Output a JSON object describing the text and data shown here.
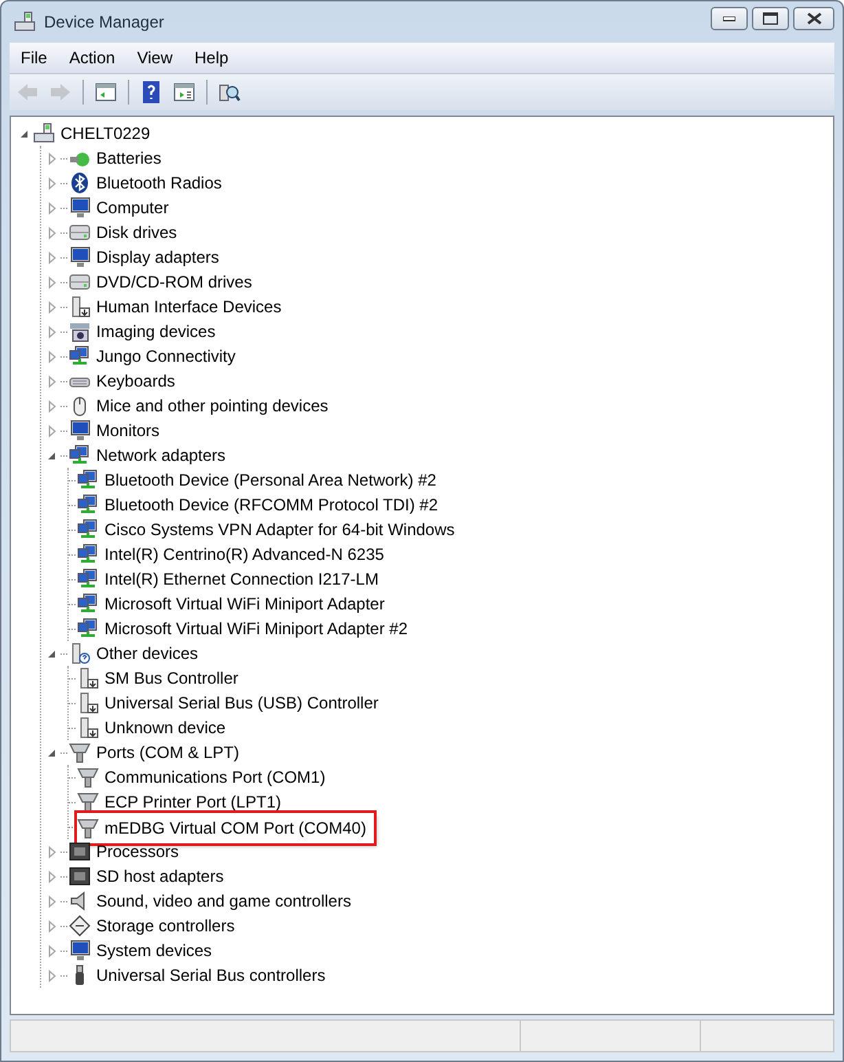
{
  "window": {
    "title": "Device Manager"
  },
  "menu": [
    "File",
    "Action",
    "View",
    "Help"
  ],
  "toolbar": [
    {
      "kind": "back",
      "disabled": true
    },
    {
      "kind": "forward",
      "disabled": true
    },
    {
      "kind": "tree",
      "disabled": false
    },
    {
      "kind": "help",
      "disabled": false
    },
    {
      "kind": "properties",
      "disabled": false
    },
    {
      "kind": "scan",
      "disabled": false
    }
  ],
  "tree": {
    "label": "CHELT0229",
    "kind": "computer",
    "expanded": true,
    "children": [
      {
        "label": "Batteries",
        "kind": "battery",
        "expanded": false
      },
      {
        "label": "Bluetooth Radios",
        "kind": "bluetooth",
        "expanded": false
      },
      {
        "label": "Computer",
        "kind": "monitor",
        "expanded": false
      },
      {
        "label": "Disk drives",
        "kind": "disk",
        "expanded": false
      },
      {
        "label": "Display adapters",
        "kind": "monitor",
        "expanded": false
      },
      {
        "label": "DVD/CD-ROM drives",
        "kind": "disk",
        "expanded": false
      },
      {
        "label": "Human Interface Devices",
        "kind": "device",
        "expanded": false
      },
      {
        "label": "Imaging devices",
        "kind": "camera",
        "expanded": false
      },
      {
        "label": "Jungo Connectivity",
        "kind": "network",
        "expanded": false
      },
      {
        "label": "Keyboards",
        "kind": "keyboard",
        "expanded": false
      },
      {
        "label": "Mice and other pointing devices",
        "kind": "mouse",
        "expanded": false
      },
      {
        "label": "Monitors",
        "kind": "monitor",
        "expanded": false
      },
      {
        "label": "Network adapters",
        "kind": "network",
        "expanded": true,
        "children": [
          {
            "label": "Bluetooth Device (Personal Area Network) #2",
            "kind": "network"
          },
          {
            "label": "Bluetooth Device (RFCOMM Protocol TDI) #2",
            "kind": "network"
          },
          {
            "label": "Cisco Systems VPN Adapter for 64-bit Windows",
            "kind": "network"
          },
          {
            "label": "Intel(R) Centrino(R) Advanced-N 6235",
            "kind": "network"
          },
          {
            "label": "Intel(R) Ethernet Connection I217-LM",
            "kind": "network"
          },
          {
            "label": "Microsoft Virtual WiFi Miniport Adapter",
            "kind": "network"
          },
          {
            "label": "Microsoft Virtual WiFi Miniport Adapter #2",
            "kind": "network"
          }
        ]
      },
      {
        "label": "Other devices",
        "kind": "unknown",
        "expanded": true,
        "children": [
          {
            "label": "SM Bus Controller",
            "kind": "device"
          },
          {
            "label": "Universal Serial Bus (USB) Controller",
            "kind": "device"
          },
          {
            "label": "Unknown device",
            "kind": "device"
          }
        ]
      },
      {
        "label": "Ports (COM & LPT)",
        "kind": "port",
        "expanded": true,
        "children": [
          {
            "label": "Communications Port (COM1)",
            "kind": "port",
            "highlighted": false
          },
          {
            "label": "ECP Printer Port (LPT1)",
            "kind": "port",
            "highlighted": false
          },
          {
            "label": "mEDBG Virtual COM Port (COM40)",
            "kind": "port",
            "highlighted": true
          }
        ]
      },
      {
        "label": "Processors",
        "kind": "chip",
        "expanded": false
      },
      {
        "label": "SD host adapters",
        "kind": "chip",
        "expanded": false
      },
      {
        "label": "Sound, video and game controllers",
        "kind": "sound",
        "expanded": false
      },
      {
        "label": "Storage controllers",
        "kind": "storage",
        "expanded": false
      },
      {
        "label": "System devices",
        "kind": "monitor",
        "expanded": false
      },
      {
        "label": "Universal Serial Bus controllers",
        "kind": "usb",
        "expanded": false
      }
    ]
  }
}
